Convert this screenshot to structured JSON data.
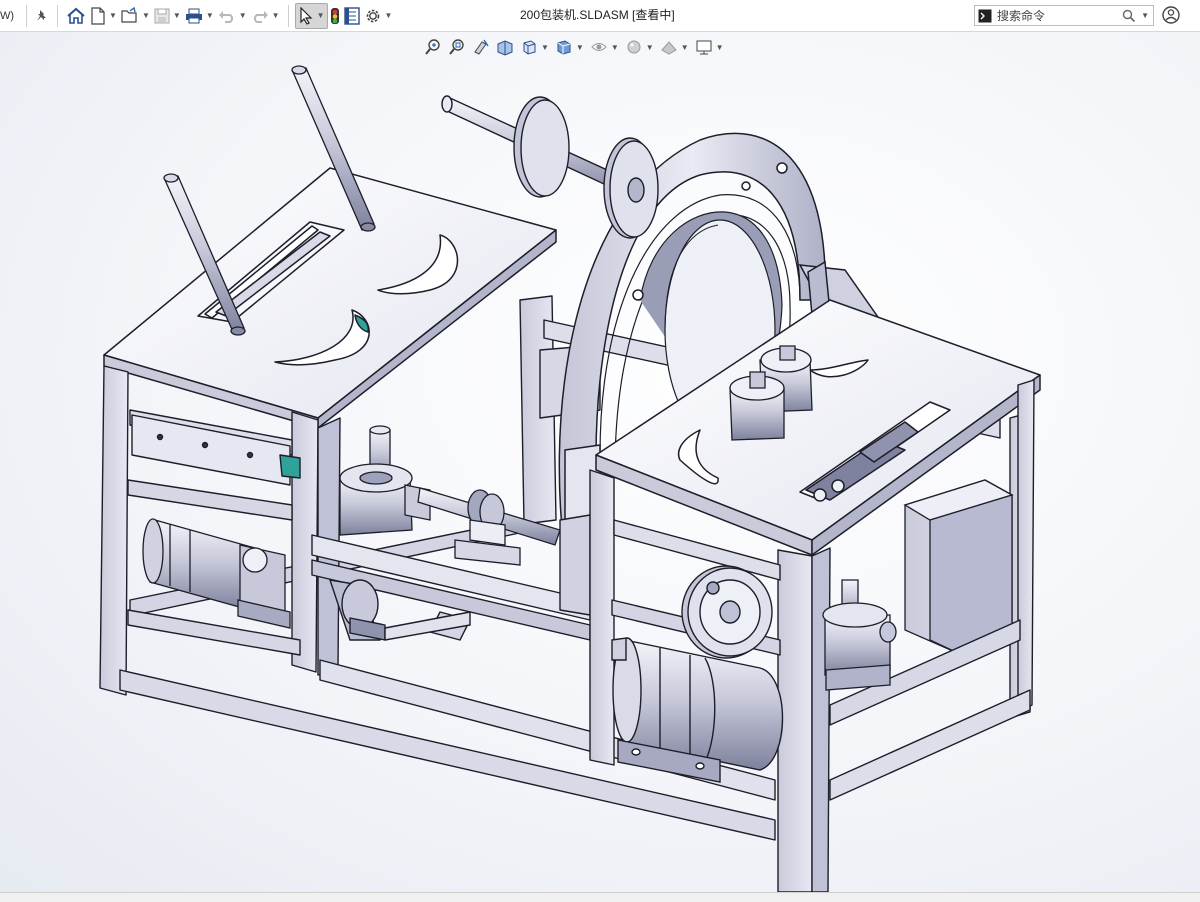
{
  "titlebar": {
    "menu_stub": "W)",
    "document_title": "200包装机.SLDASM [查看中]",
    "search_placeholder": "搜索命令"
  },
  "toolbar": {
    "items": [
      {
        "icon": "pin-icon"
      },
      {
        "icon": "home-icon"
      },
      {
        "icon": "new-document-icon",
        "dropdown": true
      },
      {
        "icon": "open-folder-icon",
        "dropdown": true
      },
      {
        "icon": "save-icon",
        "dropdown": true,
        "disabled": true
      },
      {
        "icon": "print-icon",
        "dropdown": true
      },
      {
        "icon": "undo-icon",
        "dropdown": true,
        "disabled": true
      },
      {
        "icon": "redo-icon",
        "dropdown": true,
        "disabled": true
      },
      {
        "icon": "select-pointer-icon",
        "dropdown": true,
        "active": true
      },
      {
        "icon": "traffic-light-icon"
      },
      {
        "icon": "file-properties-icon"
      },
      {
        "icon": "settings-gear-icon",
        "dropdown": true
      }
    ]
  },
  "heads_up_toolbar": {
    "items": [
      "zoom-to-fit-icon",
      "zoom-to-area-icon",
      "previous-view-icon",
      "section-view-icon",
      "view-orientation-icon",
      "display-style-icon",
      "hide-show-items-icon",
      "edit-appearance-icon",
      "apply-scene-icon",
      "view-settings-icon"
    ]
  },
  "right_icons": [
    "help-icon"
  ],
  "colors": {
    "metal": "#d9dbe8",
    "metal_dark": "#8f93ad",
    "edge": "#1e1e2a",
    "background_top": "#ffffff",
    "background_edge": "#e6eaf1",
    "accent_green": "#2fa29a"
  }
}
